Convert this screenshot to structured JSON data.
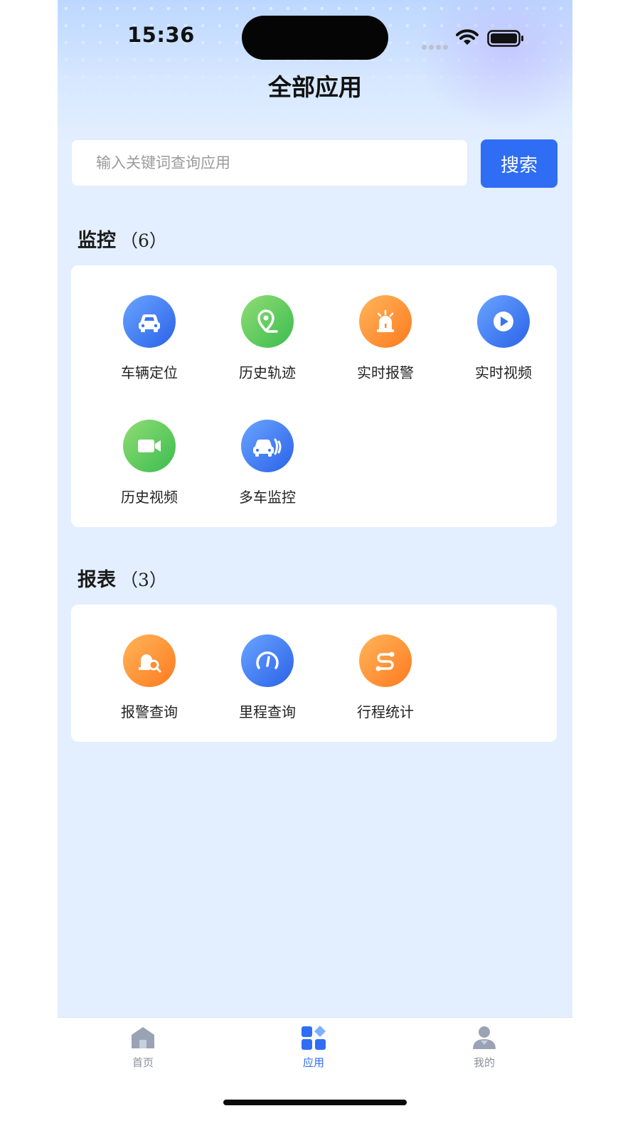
{
  "status_bar": {
    "time": "15:36"
  },
  "header": {
    "title": "全部应用"
  },
  "search": {
    "placeholder": "输入关键词查询应用",
    "button_label": "搜索"
  },
  "sections": [
    {
      "title": "监控",
      "count": "（6）",
      "apps": [
        {
          "label": "车辆定位",
          "icon": "car-icon",
          "color": "blue"
        },
        {
          "label": "历史轨迹",
          "icon": "map-pin-icon",
          "color": "green"
        },
        {
          "label": "实时报警",
          "icon": "alarm-icon",
          "color": "orange"
        },
        {
          "label": "实时视频",
          "icon": "play-icon",
          "color": "blue"
        },
        {
          "label": "历史视频",
          "icon": "video-camera-icon",
          "color": "green"
        },
        {
          "label": "多车监控",
          "icon": "multi-car-icon",
          "color": "blue"
        }
      ]
    },
    {
      "title": "报表",
      "count": "（3）",
      "apps": [
        {
          "label": "报警查询",
          "icon": "alarm-search-icon",
          "color": "orange"
        },
        {
          "label": "里程查询",
          "icon": "speedometer-icon",
          "color": "blue"
        },
        {
          "label": "行程统计",
          "icon": "route-icon",
          "color": "orange"
        }
      ]
    }
  ],
  "tabbar": {
    "items": [
      {
        "label": "首页",
        "icon": "home-icon",
        "active": false
      },
      {
        "label": "应用",
        "icon": "apps-grid-icon",
        "active": true
      },
      {
        "label": "我的",
        "icon": "user-icon",
        "active": false
      }
    ]
  },
  "colors": {
    "accent": "#2f6df4",
    "background": "#e3efff",
    "icon_blue": "#3a74f0",
    "icon_green": "#4cc45a",
    "icon_orange": "#ff8c2e"
  }
}
